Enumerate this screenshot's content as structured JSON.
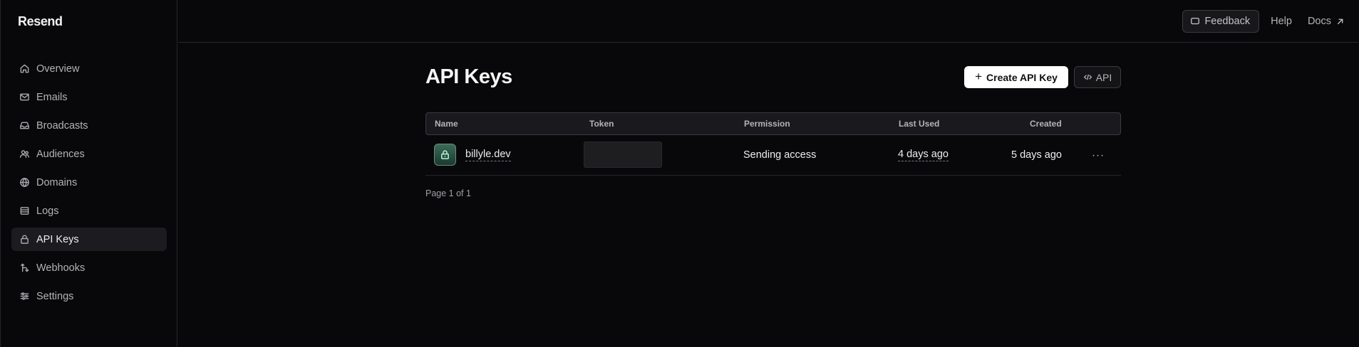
{
  "app": {
    "logo": "Resend"
  },
  "sidebar": {
    "items": [
      {
        "label": "Overview",
        "icon": "home-icon"
      },
      {
        "label": "Emails",
        "icon": "mail-icon"
      },
      {
        "label": "Broadcasts",
        "icon": "inbox-icon"
      },
      {
        "label": "Audiences",
        "icon": "users-icon"
      },
      {
        "label": "Domains",
        "icon": "globe-icon"
      },
      {
        "label": "Logs",
        "icon": "list-icon"
      },
      {
        "label": "API Keys",
        "icon": "lock-icon",
        "active": true
      },
      {
        "label": "Webhooks",
        "icon": "webhook-arrows-icon"
      },
      {
        "label": "Settings",
        "icon": "sliders-icon"
      }
    ]
  },
  "topbar": {
    "feedback": "Feedback",
    "help": "Help",
    "docs": "Docs"
  },
  "page": {
    "title": "API Keys",
    "create_button": "Create API Key",
    "api_button": "API"
  },
  "table": {
    "headers": {
      "name": "Name",
      "token": "Token",
      "permission": "Permission",
      "last_used": "Last Used",
      "created": "Created"
    },
    "rows": [
      {
        "name": "billyle.dev",
        "permission": "Sending access",
        "last_used": "4 days ago",
        "created": "5 days ago",
        "menu": "···"
      }
    ]
  },
  "pagination": {
    "label": "Page 1 of 1"
  },
  "colors": {
    "background": "#08080a",
    "accent_green": "#3c6b59",
    "primary_button": "#ffffff"
  }
}
